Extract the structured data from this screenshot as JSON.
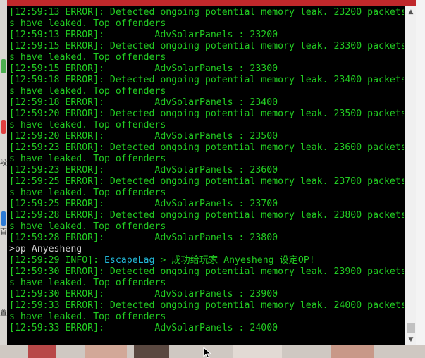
{
  "window": {
    "title_fragment": ""
  },
  "console": {
    "lines": [
      {
        "type": "log",
        "text": "[12:59:13 ERROR]: Detected ongoing potential memory leak. 23200 packets"
      },
      {
        "type": "log",
        "text": "s have leaked. Top offenders"
      },
      {
        "type": "log",
        "text": "[12:59:13 ERROR]:         AdvSolarPanels : 23200"
      },
      {
        "type": "log",
        "text": "[12:59:15 ERROR]: Detected ongoing potential memory leak. 23300 packets"
      },
      {
        "type": "log",
        "text": "s have leaked. Top offenders"
      },
      {
        "type": "log",
        "text": "[12:59:15 ERROR]:         AdvSolarPanels : 23300"
      },
      {
        "type": "log",
        "text": "[12:59:18 ERROR]: Detected ongoing potential memory leak. 23400 packets"
      },
      {
        "type": "log",
        "text": "s have leaked. Top offenders"
      },
      {
        "type": "log",
        "text": "[12:59:18 ERROR]:         AdvSolarPanels : 23400"
      },
      {
        "type": "log",
        "text": "[12:59:20 ERROR]: Detected ongoing potential memory leak. 23500 packets"
      },
      {
        "type": "log",
        "text": "s have leaked. Top offenders"
      },
      {
        "type": "log",
        "text": "[12:59:20 ERROR]:         AdvSolarPanels : 23500"
      },
      {
        "type": "log",
        "text": "[12:59:23 ERROR]: Detected ongoing potential memory leak. 23600 packets"
      },
      {
        "type": "log",
        "text": "s have leaked. Top offenders"
      },
      {
        "type": "log",
        "text": "[12:59:23 ERROR]:         AdvSolarPanels : 23600"
      },
      {
        "type": "log",
        "text": "[12:59:25 ERROR]: Detected ongoing potential memory leak. 23700 packets"
      },
      {
        "type": "log",
        "text": "s have leaked. Top offenders"
      },
      {
        "type": "log",
        "text": "[12:59:25 ERROR]:         AdvSolarPanels : 23700"
      },
      {
        "type": "log",
        "text": "[12:59:28 ERROR]: Detected ongoing potential memory leak. 23800 packets"
      },
      {
        "type": "log",
        "text": "s have leaked. Top offenders"
      },
      {
        "type": "log",
        "text": "[12:59:28 ERROR]:         AdvSolarPanels : 23800"
      },
      {
        "type": "command",
        "text": ">op Anyesheng"
      },
      {
        "type": "info",
        "prefix": "[12:59:29 INFO]: ",
        "source": "EscapeLag",
        "message": " > 成功给玩家 Anyesheng 设定OP!"
      },
      {
        "type": "log",
        "text": "[12:59:30 ERROR]: Detected ongoing potential memory leak. 23900 packets"
      },
      {
        "type": "log",
        "text": "s have leaked. Top offenders"
      },
      {
        "type": "log",
        "text": "[12:59:30 ERROR]:         AdvSolarPanels : 23900"
      },
      {
        "type": "log",
        "text": "[12:59:33 ERROR]: Detected ongoing potential memory leak. 24000 packets"
      },
      {
        "type": "log",
        "text": "s have leaked. Top offenders"
      },
      {
        "type": "log",
        "text": "[12:59:33 ERROR]:         AdvSolarPanels : 24000"
      }
    ]
  },
  "scrollbar": {
    "up_icon": "chevron-up-icon",
    "down_icon": "chevron-down-icon"
  },
  "colors": {
    "console_bg": "#000000",
    "log_text": "#22cc22",
    "info_source": "#22b8d8",
    "command_text": "#cfcfcf",
    "titlebar": "#c0282b"
  }
}
